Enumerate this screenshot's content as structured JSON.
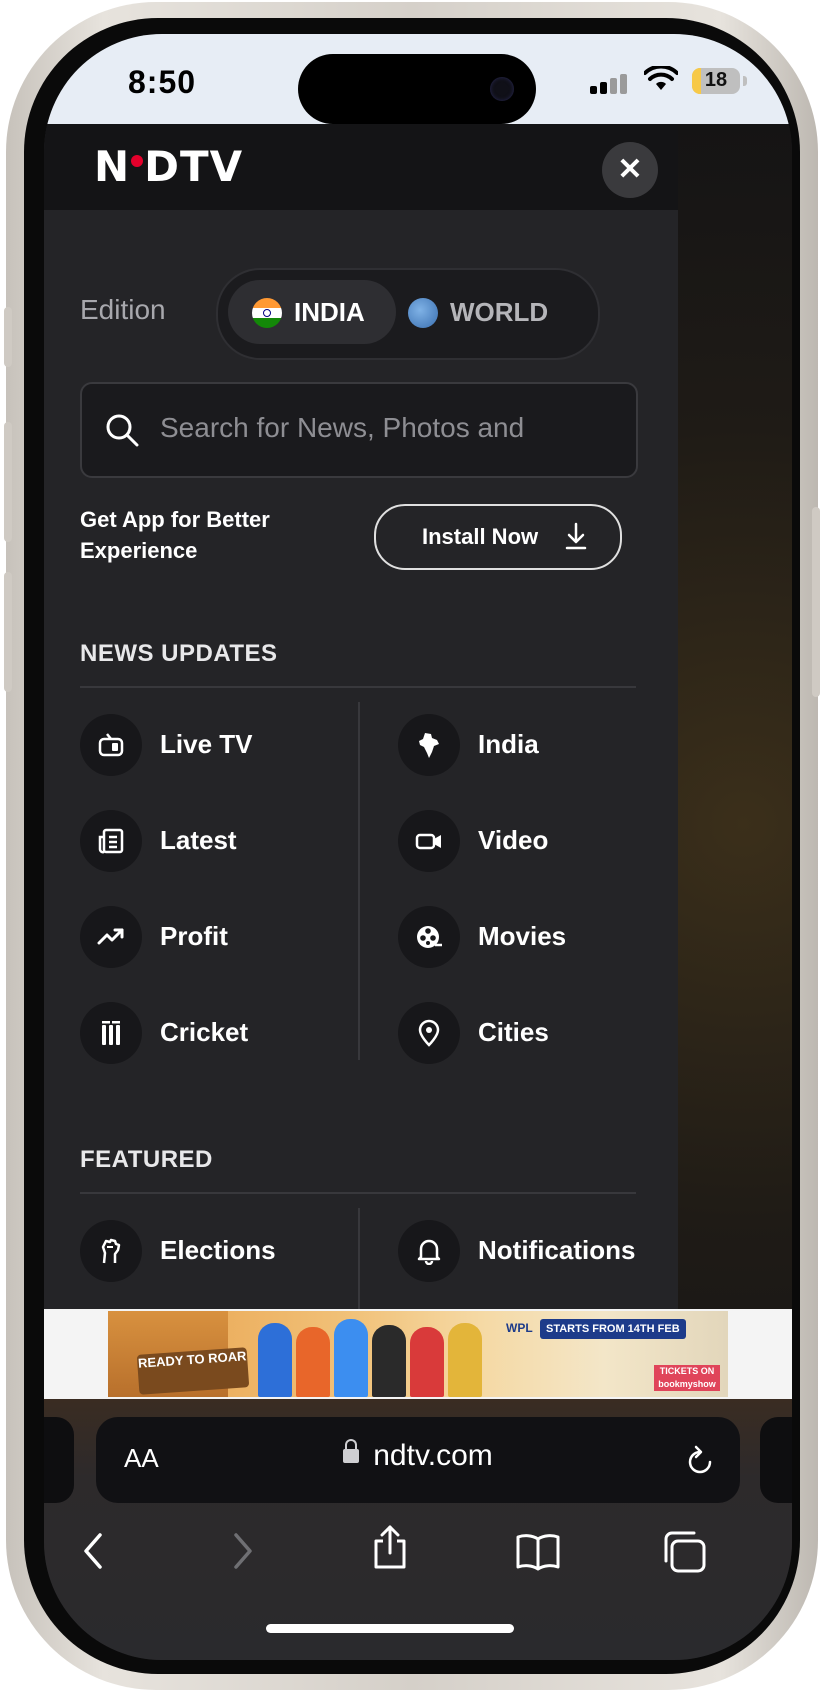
{
  "status_bar": {
    "time": "8:50",
    "battery": "18",
    "battery_level": 0.18
  },
  "menu": {
    "logo": {
      "left": "N",
      "right": "DTV"
    },
    "close_label": "✕",
    "edition": {
      "label": "Edition",
      "options": [
        {
          "label": "INDIA",
          "selected": true
        },
        {
          "label": "WORLD",
          "selected": false
        }
      ]
    },
    "search": {
      "placeholder": "Search for News, Photos and"
    },
    "get_app": {
      "text": "Get App for Better Experience",
      "button": "Install Now"
    },
    "news_updates": {
      "title": "NEWS UPDATES",
      "left": [
        {
          "label": "Live TV",
          "icon": "tv-icon"
        },
        {
          "label": "Latest",
          "icon": "newspaper-icon"
        },
        {
          "label": "Profit",
          "icon": "trending-up-icon"
        },
        {
          "label": "Cricket",
          "icon": "cricket-stumps-icon"
        }
      ],
      "right": [
        {
          "label": "India",
          "icon": "india-map-icon"
        },
        {
          "label": "Video",
          "icon": "video-camera-icon"
        },
        {
          "label": "Movies",
          "icon": "film-reel-icon"
        },
        {
          "label": "Cities",
          "icon": "location-pin-icon"
        }
      ]
    },
    "featured": {
      "title": "FEATURED",
      "left": [
        {
          "label": "Elections",
          "icon": "raised-fist-icon"
        }
      ],
      "right": [
        {
          "label": "Notifications",
          "icon": "bell-icon"
        }
      ]
    }
  },
  "ad": {
    "headline": "READY TO ROAR",
    "brand": "WPL",
    "date_text": "STARTS FROM 14TH FEB",
    "tickets": "TICKETS ON bookmyshow"
  },
  "browser": {
    "text_size_label": "AA",
    "url": "ndtv.com",
    "toolbar": [
      "back-icon",
      "forward-icon",
      "share-icon",
      "bookmarks-icon",
      "tabs-icon"
    ]
  }
}
